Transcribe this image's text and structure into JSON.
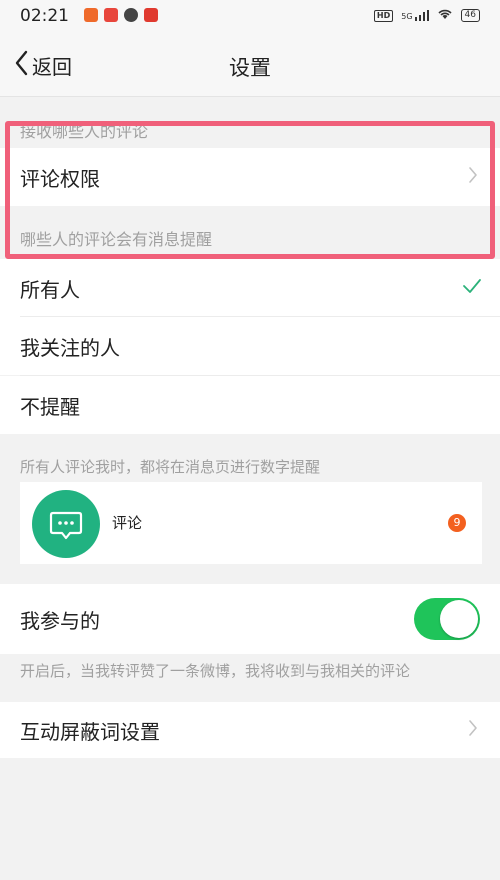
{
  "status_bar": {
    "time": "02:21",
    "hd": "HD",
    "network": "5G",
    "battery": "46"
  },
  "nav": {
    "back_label": "返回",
    "title": "设置"
  },
  "sections": {
    "receive_from": "接收哪些人的评论",
    "notify_who": "哪些人的评论会有消息提醒",
    "notify_hint": "所有人评论我时，都将在消息页进行数字提醒"
  },
  "rows": {
    "comment_permission": "评论权限",
    "everyone": "所有人",
    "following": "我关注的人",
    "no_notify": "不提醒",
    "participated": "我参与的",
    "blocked_words": "互动屏蔽词设置"
  },
  "preview": {
    "label": "评论",
    "badge": "9"
  },
  "participated_hint": "开启后，当我转评赞了一条微博，我将收到与我相关的评论",
  "toggle": {
    "participated_on": true
  },
  "colors": {
    "accent_green": "#1fc45a",
    "check_green": "#2bb27a",
    "badge_orange": "#f3601f",
    "highlight_red": "#f0607a"
  }
}
